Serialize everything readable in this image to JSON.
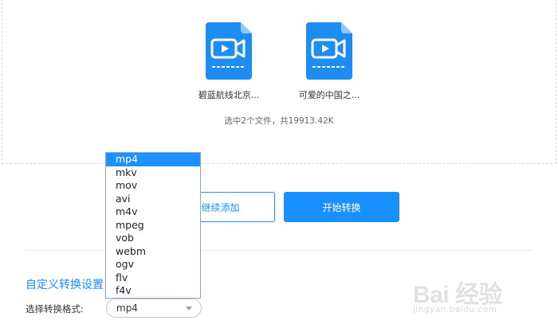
{
  "files": [
    {
      "name": "碧蓝航线北京...",
      "icon": "video-file-icon"
    },
    {
      "name": "可爱的中国之...",
      "icon": "video-file-icon"
    }
  ],
  "summary": "选中2个文件，共19913.42K",
  "buttons": {
    "add_label": "继续添加",
    "start_label": "开始转换"
  },
  "settings": {
    "title": "自定义转换设置",
    "format_label": "选择转换格式:",
    "format_value": "mp4"
  },
  "dropdown": {
    "options": [
      "mp4",
      "mkv",
      "mov",
      "avi",
      "m4v",
      "mpeg",
      "vob",
      "webm",
      "ogv",
      "flv",
      "f4v"
    ],
    "selected": "mp4"
  },
  "watermark": {
    "logo_text": "Bai 经验",
    "sub_text": "jingyan.baidu.com"
  },
  "colors": {
    "accent": "#1890ff",
    "icon_blue": "#1e8cf0",
    "selected_option": "#1e90ff"
  }
}
